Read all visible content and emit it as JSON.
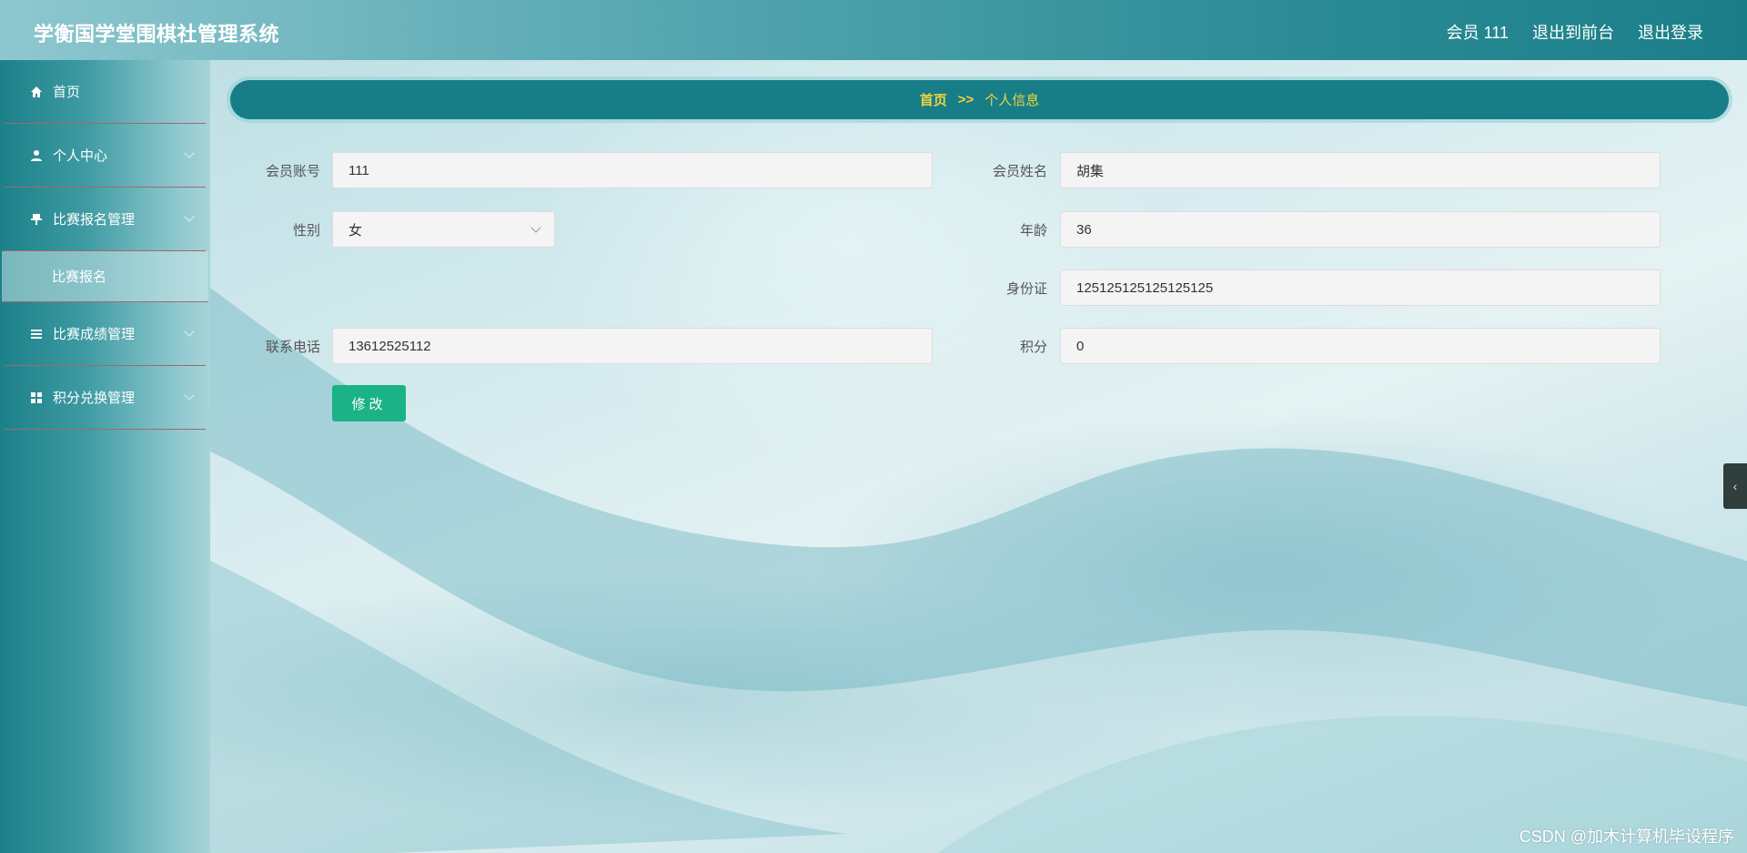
{
  "header": {
    "app_title": "学衡国学堂围棋社管理系统",
    "user_label": "会员 111",
    "front_link": "退出到前台",
    "logout_link": "退出登录"
  },
  "sidebar": {
    "items": [
      {
        "label": "首页",
        "icon": "home-icon"
      },
      {
        "label": "个人中心",
        "icon": "user-icon"
      },
      {
        "label": "比赛报名管理",
        "icon": "pin-icon"
      },
      {
        "label": "比赛报名",
        "icon": ""
      },
      {
        "label": "比赛成绩管理",
        "icon": "list-icon"
      },
      {
        "label": "积分兑换管理",
        "icon": "grid-icon"
      }
    ]
  },
  "breadcrumb": {
    "home": "首页",
    "separator": ">>",
    "current": "个人信息"
  },
  "form": {
    "account_label": "会员账号",
    "account_value": "111",
    "name_label": "会员姓名",
    "name_value": "胡集",
    "gender_label": "性别",
    "gender_value": "女",
    "age_label": "年龄",
    "age_value": "36",
    "id_label": "身份证",
    "id_value": "125125125125125125",
    "phone_label": "联系电话",
    "phone_value": "13612525112",
    "points_label": "积分",
    "points_value": "0",
    "submit_label": "修改"
  },
  "watermark": "CSDN @加木计算机毕设程序",
  "colors": {
    "accent": "#177e88",
    "breadcrumb_text": "#f2d23c",
    "button": "#1bb386"
  }
}
